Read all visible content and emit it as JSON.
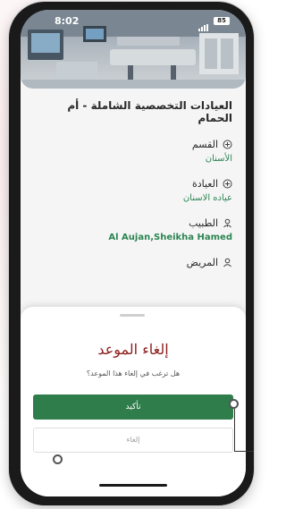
{
  "status_bar": {
    "time": "8:02",
    "battery": "85"
  },
  "clinic": {
    "title": "العيادات التخصصية الشاملة - أم الحمام"
  },
  "fields": [
    {
      "label": "القسم",
      "value": "الأسنان",
      "icon": "info-circle-icon"
    },
    {
      "label": "العيادة",
      "value": "عياده الاسنان",
      "icon": "info-circle-icon"
    },
    {
      "label": "الطبيب",
      "value": "Al Aujan,Sheikha Hamed",
      "icon": "doctor-icon"
    },
    {
      "label": "المريض",
      "value": "",
      "icon": "person-icon"
    }
  ],
  "dialog": {
    "title": "إلغاء الموعد",
    "message": "هل ترغب في إلغاء هذا الموعد؟",
    "confirm_label": "تأكيد",
    "cancel_label": "إلغاء"
  },
  "colors": {
    "accent_green": "#2f7d4a",
    "value_green": "#2e8b57",
    "title_red": "#8c1c1c"
  }
}
